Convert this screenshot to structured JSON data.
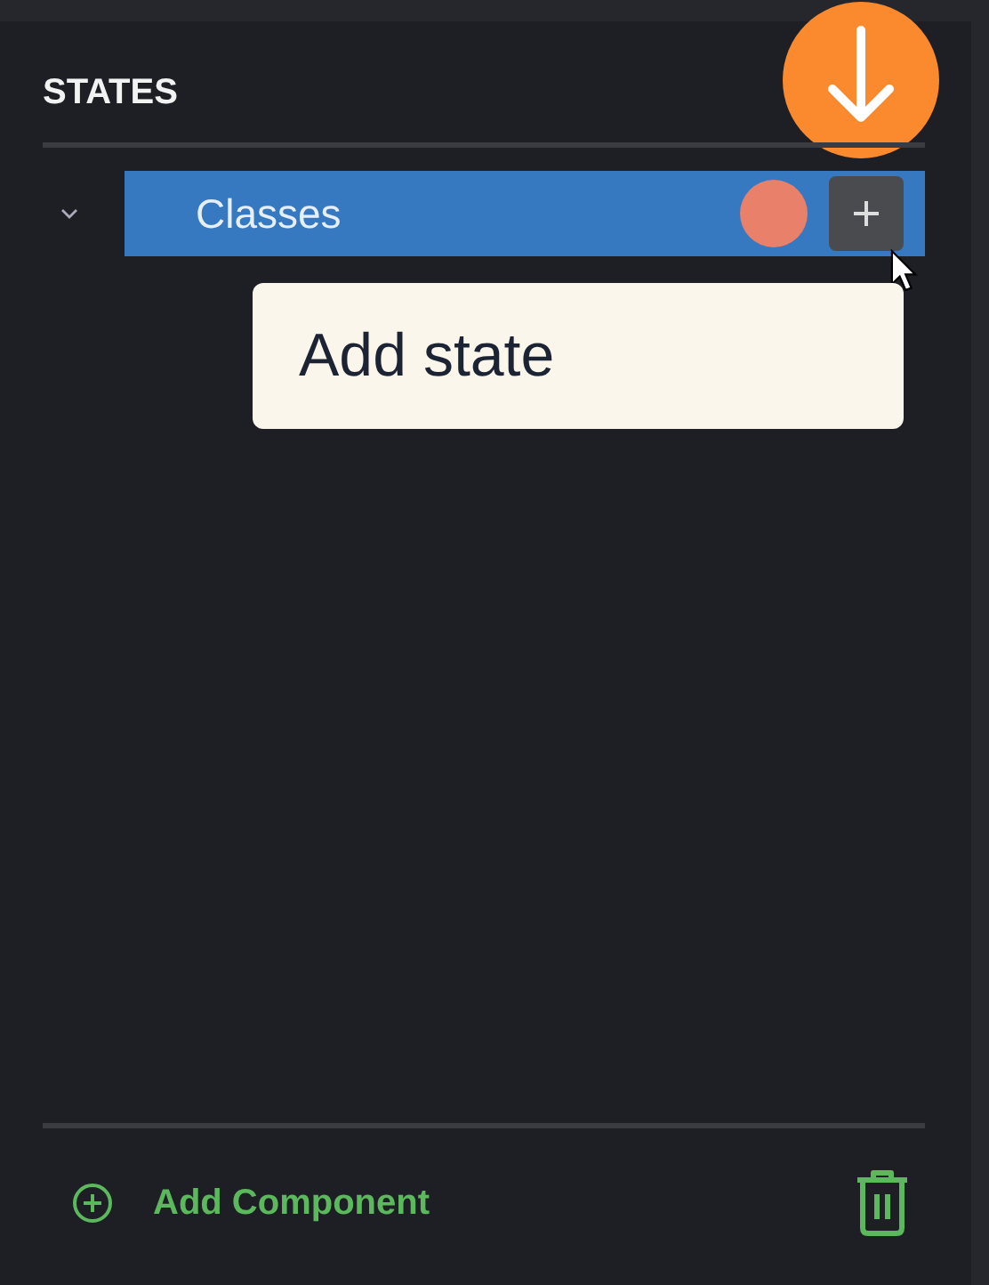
{
  "panel": {
    "title": "STATES"
  },
  "tree": [
    {
      "label": "Classes",
      "expanded": true,
      "selected": true,
      "color": "#e8806a"
    }
  ],
  "tooltip": {
    "text": "Add state"
  },
  "footer": {
    "add_label": "Add Component"
  }
}
